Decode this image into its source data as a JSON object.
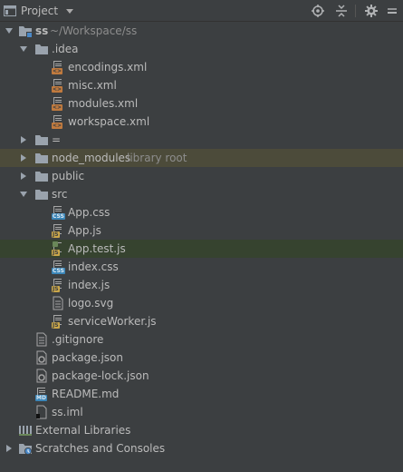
{
  "panel": {
    "title": "Project"
  },
  "tree": {
    "root": {
      "label": "ss",
      "hint": "~/Workspace/ss"
    },
    "idea": {
      "label": ".idea",
      "files": [
        "encodings.xml",
        "misc.xml",
        "modules.xml",
        "workspace.xml"
      ]
    },
    "eq_folder": {
      "label": "="
    },
    "node_modules": {
      "label": "node_modules",
      "hint": "library root"
    },
    "public": {
      "label": "public"
    },
    "src": {
      "label": "src",
      "files": [
        "App.css",
        "App.js",
        "App.test.js",
        "index.css",
        "index.js",
        "logo.svg",
        "serviceWorker.js"
      ]
    },
    "root_files": [
      ".gitignore",
      "package.json",
      "package-lock.json",
      "README.md",
      "ss.iml"
    ],
    "external_libraries": "External Libraries",
    "scratches": "Scratches and Consoles"
  },
  "icon_tags": {
    "xml": "<>",
    "css": "CSS",
    "js": "JS",
    "md": "MD"
  },
  "colors": {
    "background": "#3c3f41",
    "text": "#bbbbbb",
    "hint": "#8d8d8d",
    "folder": "#9ba3ad",
    "library_row": "#4c4b3a",
    "selected_row": "#36432f",
    "xml_badge": "#c07a3e",
    "css_badge": "#3b86b8",
    "js_badge": "#c9a64a",
    "md_badge": "#3b86b8"
  }
}
